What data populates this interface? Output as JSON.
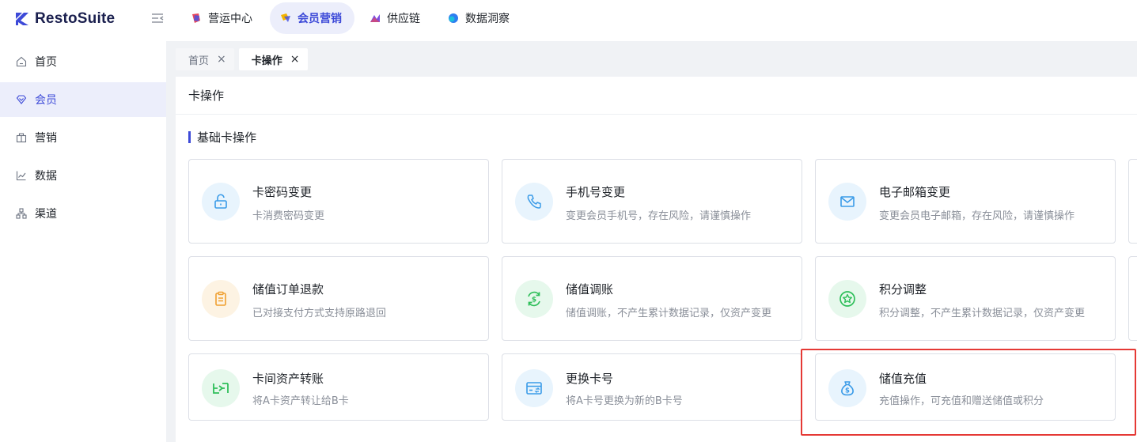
{
  "app": {
    "brand": "RestoSuite",
    "top_nav": [
      {
        "label": "营运中心",
        "icon": "operations-icon",
        "color": "#e8475c"
      },
      {
        "label": "会员营销",
        "icon": "member-marketing-icon",
        "color": "#f5b400"
      },
      {
        "label": "供应链",
        "icon": "supply-chain-icon",
        "color": "#7a4de0"
      },
      {
        "label": "数据洞察",
        "icon": "data-insight-icon",
        "color": "#2e7df0"
      }
    ],
    "accent": "#3d4ad8"
  },
  "sidebar": {
    "items": [
      {
        "label": "首页",
        "icon": "home-icon"
      },
      {
        "label": "会员",
        "icon": "member-icon",
        "active": true
      },
      {
        "label": "营销",
        "icon": "marketing-icon"
      },
      {
        "label": "数据",
        "icon": "data-chart-icon"
      },
      {
        "label": "渠道",
        "icon": "channel-icon"
      }
    ]
  },
  "tabs": [
    {
      "label": "首页",
      "close": "×"
    },
    {
      "label": "卡操作",
      "close": "×",
      "active": true
    }
  ],
  "main": {
    "title": "卡操作",
    "section_title": "基础卡操作",
    "cards": [
      {
        "title": "卡密码变更",
        "desc": "卡消费密码变更",
        "icon": "unlock-icon",
        "icon_bg": "#e8f4fd",
        "icon_color": "#3a9be8"
      },
      {
        "title": "手机号变更",
        "desc": "变更会员手机号，存在风险，请谨慎操作",
        "icon": "phone-icon",
        "icon_bg": "#e8f4fd",
        "icon_color": "#3a9be8"
      },
      {
        "title": "电子邮箱变更",
        "desc": "变更会员电子邮箱，存在风险，请谨慎操作",
        "icon": "mail-icon",
        "icon_bg": "#e8f4fd",
        "icon_color": "#3a9be8"
      },
      {
        "title": "储值订单退款",
        "desc": "已对接支付方式支持原路退回",
        "icon": "refund-order-icon",
        "icon_bg": "#fdf3e3",
        "icon_color": "#f0a030"
      },
      {
        "title": "储值调账",
        "desc": "储值调账，不产生累计数据记录，仅资产变更",
        "icon": "adjust-balance-icon",
        "icon_bg": "#e6f8ec",
        "icon_color": "#2fbf5a"
      },
      {
        "title": "积分调整",
        "desc": "积分调整，不产生累计数据记录，仅资产变更",
        "icon": "points-star-icon",
        "icon_bg": "#e6f8ec",
        "icon_color": "#2fbf5a"
      },
      {
        "title": "卡间资产转账",
        "desc": "将A卡资产转让给B卡",
        "icon": "transfer-icon",
        "icon_bg": "#e6f8ec",
        "icon_color": "#2fbf5a"
      },
      {
        "title": "更换卡号",
        "desc": "将A卡号更换为新的B卡号",
        "icon": "card-swap-icon",
        "icon_bg": "#e8f4fd",
        "icon_color": "#3a9be8"
      },
      {
        "title": "储值充值",
        "desc": "充值操作，可充值和赠送储值或积分",
        "icon": "money-bag-icon",
        "icon_bg": "#e8f4fd",
        "icon_color": "#3a9be8"
      }
    ]
  }
}
